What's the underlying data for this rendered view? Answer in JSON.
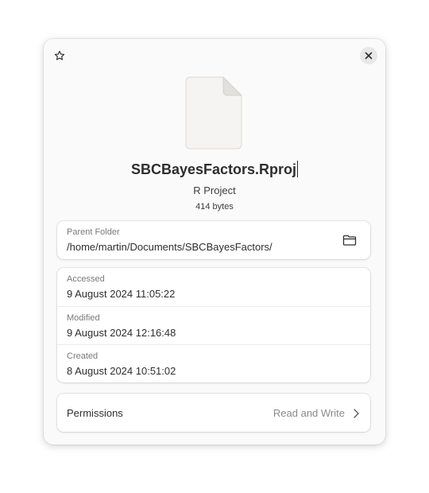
{
  "header": {
    "star_icon": "star-outline-icon",
    "close_icon": "close-icon"
  },
  "file": {
    "icon": "generic-file-icon",
    "name": "SBCBayesFactors.Rproj",
    "type": "R Project",
    "size": "414 bytes"
  },
  "parent_folder": {
    "label": "Parent Folder",
    "path": "/home/martin/Documents/SBCBayesFactors/",
    "open_icon": "folder-open-icon"
  },
  "dates": [
    {
      "label": "Accessed",
      "value": "9 August 2024 11:05:22"
    },
    {
      "label": "Modified",
      "value": "9 August 2024 12:16:48"
    },
    {
      "label": "Created",
      "value": "8 August 2024 10:51:02"
    }
  ],
  "permissions": {
    "label": "Permissions",
    "value": "Read and Write",
    "chevron_icon": "chevron-right-icon"
  },
  "colors": {
    "dialog_bg": "#fafafa",
    "card_bg": "#ffffff",
    "text": "#2e2e2e",
    "muted": "#7a7a7a"
  }
}
